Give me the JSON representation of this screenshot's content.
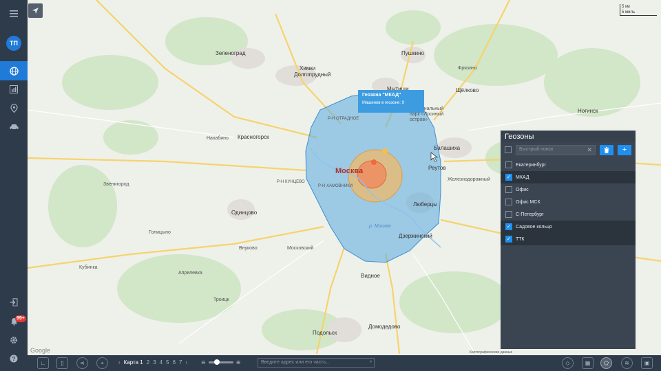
{
  "sidebar": {
    "avatar_initials": "ТП",
    "notification_count": "99+",
    "items": [
      "globe-icon",
      "chart-icon",
      "location-pin-icon",
      "car-icon"
    ]
  },
  "map": {
    "labels": {
      "zelenograd": "Зеленоград",
      "khimki": "Химки",
      "dolgoprudny": "Долгопрудный",
      "mytishchi": "Мытищи",
      "pushkino": "Пушкино",
      "schelkovo": "Щёлково",
      "balashikha": "Балашиха",
      "reutov": "Реутов",
      "krasnogorsk": "Красногорск",
      "moscow": "Москва",
      "odintsovo": "Одинцово",
      "lyubertsy": "Люберцы",
      "zheleznodorozhny": "Железнодорожный",
      "dzerzhinsky": "Дзержинский",
      "vidnoe": "Видное",
      "podolsk": "Подольск",
      "domodedovo": "Домодедово",
      "noginsk": "Ногинск",
      "fryazino": "Фрязино",
      "golitsyno": "Голицыно",
      "kubinka": "Кубинка",
      "nakhabino": "Нахабино",
      "vnukovo": "Внуково",
      "moskovsky": "Московский",
      "troitsk": "Троицк",
      "aprelevka": "Апрелевка",
      "zvenigorod": "Звенигород",
      "losiny": "Национальный парк «Лосиный остров»",
      "otradnoe": "Р-Н ОТРАДНОЕ",
      "khamovniki": "Р-Н ХАМОВНИКИ",
      "kuntsevo": "Р-Н КУНЦЕВО",
      "moskva_river": "р. Москва",
      "google": "Google",
      "attribution": "Картографические данные"
    },
    "scale": {
      "km": "5 км",
      "mi": "5 миль"
    }
  },
  "tooltip": {
    "title": "Геозона \"МКАД\"",
    "subtitle": "Машинов в геозоне: 9"
  },
  "geozones": {
    "title": "Геозоны",
    "search_placeholder": "Быстрый поиск",
    "delete_label": "🗑",
    "add_label": "+",
    "items": [
      {
        "label": "Екатеринбург",
        "checked": false
      },
      {
        "label": "МКАД",
        "checked": true
      },
      {
        "label": "Офис",
        "checked": false
      },
      {
        "label": "Офис МСК",
        "checked": false
      },
      {
        "label": "С-Петербург",
        "checked": false
      },
      {
        "label": "Садовое кольцо",
        "checked": true
      },
      {
        "label": "ТТК",
        "checked": true
      }
    ]
  },
  "bottombar": {
    "map_tab_current": "Карта 1",
    "tabs": [
      "2",
      "3",
      "4",
      "5",
      "6",
      "7"
    ],
    "address_placeholder": "Введите адрес или его часть..."
  },
  "colors": {
    "accent": "#1f7ad8",
    "mkad_fill": "#5aa9df",
    "ttk_fill": "#f0b86a",
    "sadovoe_fill": "#f08a5d"
  }
}
